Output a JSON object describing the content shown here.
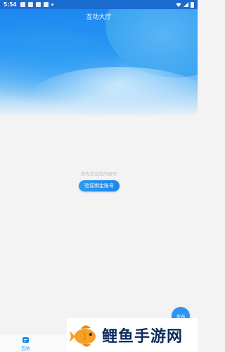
{
  "status_bar": {
    "time": "5:54"
  },
  "header": {
    "title": "互动大厅"
  },
  "empty_state": {
    "hint": "请先验证您的账号",
    "button_label": "验证绑定账号"
  },
  "fab": {
    "label": "发布"
  },
  "bottom_nav": {
    "items": [
      {
        "label": "互动",
        "icon": "chat-icon",
        "active": true
      }
    ]
  },
  "watermark": {
    "text": "鲤鱼手游网",
    "logo": "fish-logo"
  },
  "colors": {
    "accent": "#1f86e8",
    "hero_top": "#1a84f0",
    "background": "#f3f3f3",
    "watermark_text": "#0c2b5b",
    "fish_orange": "#f4a125"
  }
}
